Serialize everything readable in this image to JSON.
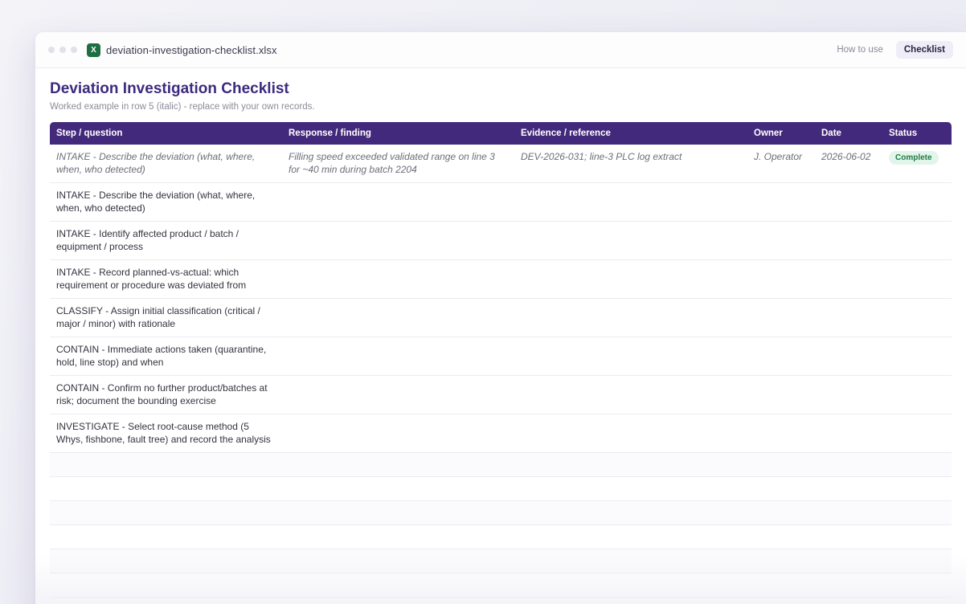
{
  "window": {
    "filename": "deviation-investigation-checklist.xlsx",
    "file_icon_letter": "X",
    "tabs": [
      {
        "label": "How to use",
        "active": false
      },
      {
        "label": "Checklist",
        "active": true
      }
    ]
  },
  "sheet": {
    "title": "Deviation Investigation Checklist",
    "subtitle": "Worked example in row 5 (italic) - replace with your own records.",
    "columns": [
      "Step / question",
      "Response / finding",
      "Evidence / reference",
      "Owner",
      "Date",
      "Status"
    ],
    "example_row": {
      "step": "INTAKE - Describe the deviation (what, where, when, who detected)",
      "response": "Filling speed exceeded validated range on line 3 for ~40 min during batch 2204",
      "evidence": "DEV-2026-031; line-3 PLC log extract",
      "owner": "J. Operator",
      "date": "2026-06-02",
      "status": "Complete"
    },
    "rows": [
      {
        "step": "INTAKE - Describe the deviation (what, where, when, who detected)"
      },
      {
        "step": "INTAKE - Identify affected product / batch / equipment / process"
      },
      {
        "step": "INTAKE - Record planned-vs-actual: which requirement or procedure was deviated from"
      },
      {
        "step": "CLASSIFY - Assign initial classification (critical / major / minor) with rationale"
      },
      {
        "step": "CONTAIN - Immediate actions taken (quarantine, hold, line stop) and when"
      },
      {
        "step": "CONTAIN - Confirm no further product/batches at risk; document the bounding exercise"
      },
      {
        "step": "INVESTIGATE - Select root-cause method (5 Whys, fishbone, fault tree) and record the analysis"
      }
    ]
  },
  "colors": {
    "header_bg": "#43297b",
    "title": "#3d2a7e",
    "status_complete_bg": "#e2f5ea",
    "status_complete_text": "#1f7a45",
    "excel_icon": "#1d6f42"
  }
}
